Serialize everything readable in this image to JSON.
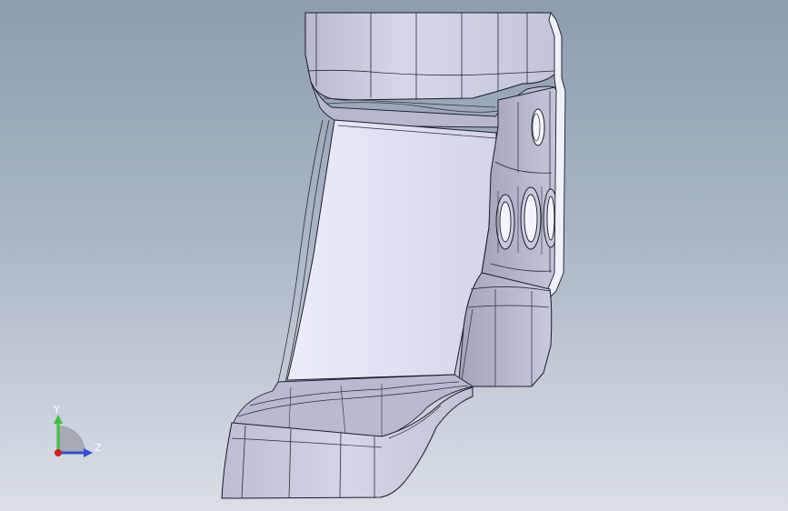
{
  "viewport": {
    "background_top": "#8d9db0",
    "background_bottom": "#dadfe6"
  },
  "model": {
    "face_light": "#dfe0f0",
    "face_mid": "#c9cadf",
    "face_dark": "#a9aac0",
    "edge": "#1a1a2a"
  },
  "triad": {
    "y_label": "Y",
    "z_label": "Z",
    "y_color": "#3fbf3f",
    "z_color": "#2f4fd8",
    "x_color": "#d02020"
  }
}
